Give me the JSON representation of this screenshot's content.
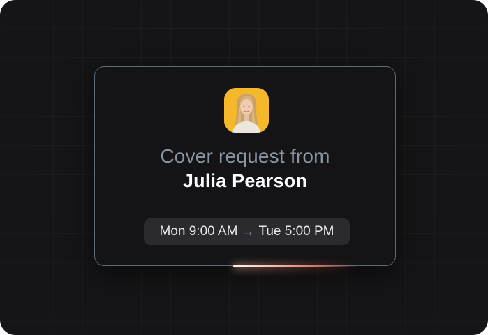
{
  "card": {
    "title_prefix": "Cover request from",
    "requester_name": "Julia Pearson",
    "time_start": "Mon 9:00 AM",
    "time_end": "Tue 5:00 PM",
    "arrow_symbol": "→",
    "avatar_icon": "profile-photo-icon"
  },
  "colors": {
    "background": "#151517",
    "card_border": "#5d6a78",
    "avatar_bg": "#f5b82a",
    "muted_text": "#8a95a4",
    "pill_bg": "#2b2b2f"
  },
  "progress": {
    "value": 0.4
  }
}
